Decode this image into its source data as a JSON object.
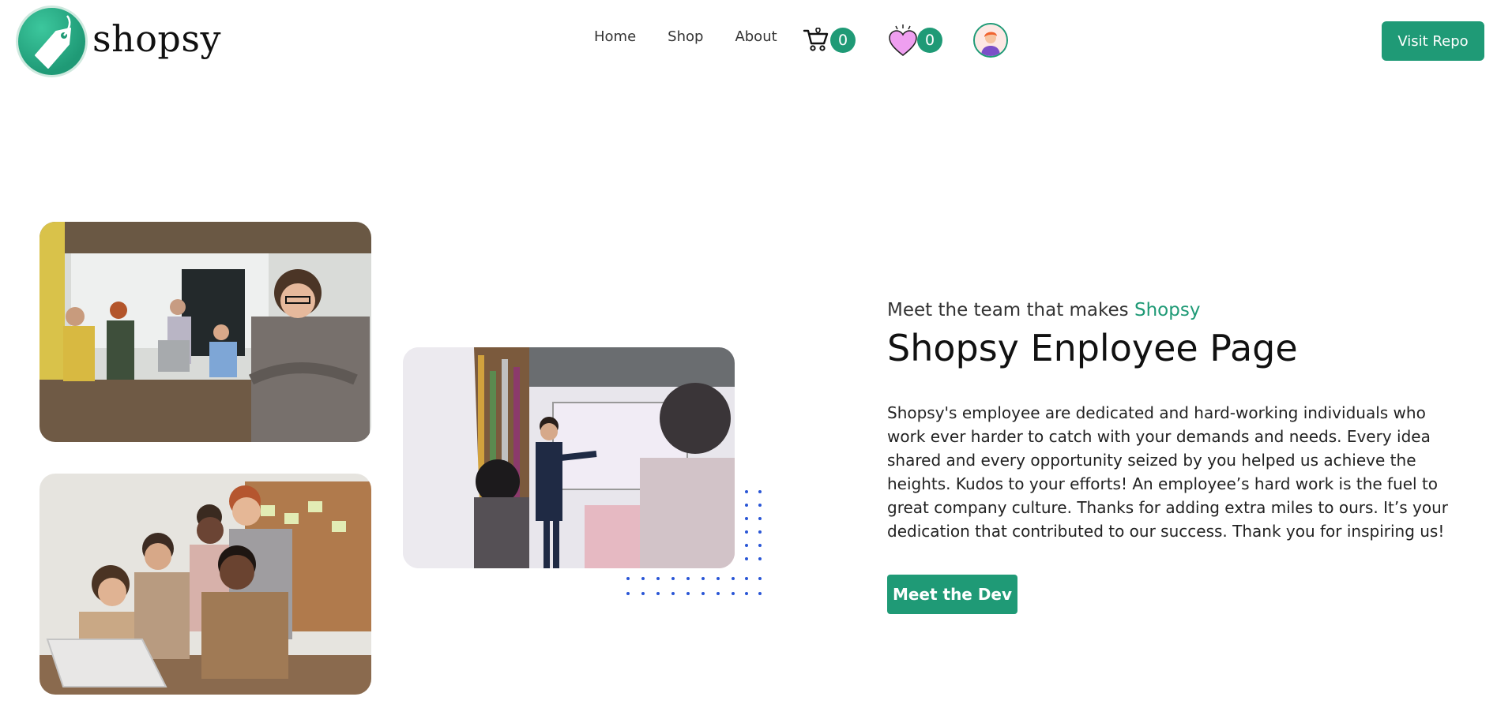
{
  "brand": {
    "name": "shopsy",
    "logo_icon": "price-tag-icon"
  },
  "nav": {
    "items": [
      {
        "label": "Home"
      },
      {
        "label": "Shop"
      },
      {
        "label": "About"
      }
    ]
  },
  "cart": {
    "icon": "shopping-cart-icon",
    "count": "0"
  },
  "wishlist": {
    "icon": "heart-icon",
    "count": "0"
  },
  "profile": {
    "icon": "user-avatar-icon"
  },
  "visit_repo": {
    "label": "Visit Repo"
  },
  "hero": {
    "subtitle_prefix": "Meet the team that makes ",
    "subtitle_accent": "Shopsy",
    "title": "Shopsy Enployee Page",
    "description": "Shopsy's employee are dedicated and hard-working individuals who work ever harder to catch with your demands and needs. Every idea shared and every opportunity seized by you helped us achieve the heights. Kudos to your efforts! An employee’s hard work is the fuel to great company culture. Thanks for adding extra miles to ours. It’s your dedication that contributed to our success. Thank you for inspiring us!",
    "button_label": "Meet the Dev"
  },
  "colors": {
    "accent": "#1f9a76",
    "dots": "#2a56d6"
  }
}
